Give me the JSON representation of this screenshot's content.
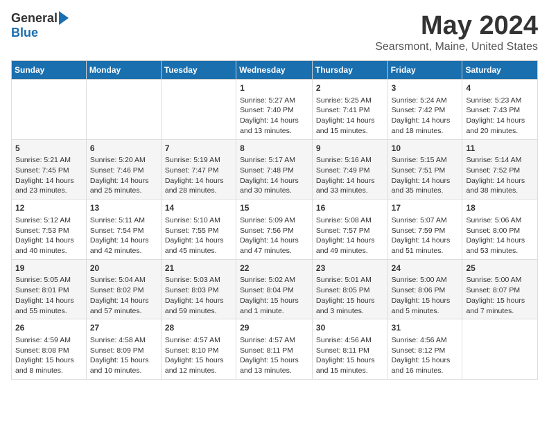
{
  "logo": {
    "general": "General",
    "blue": "Blue"
  },
  "title": "May 2024",
  "subtitle": "Searsmont, Maine, United States",
  "days_of_week": [
    "Sunday",
    "Monday",
    "Tuesday",
    "Wednesday",
    "Thursday",
    "Friday",
    "Saturday"
  ],
  "weeks": [
    [
      {
        "day": "",
        "info": ""
      },
      {
        "day": "",
        "info": ""
      },
      {
        "day": "",
        "info": ""
      },
      {
        "day": "1",
        "info": "Sunrise: 5:27 AM\nSunset: 7:40 PM\nDaylight: 14 hours\nand 13 minutes."
      },
      {
        "day": "2",
        "info": "Sunrise: 5:25 AM\nSunset: 7:41 PM\nDaylight: 14 hours\nand 15 minutes."
      },
      {
        "day": "3",
        "info": "Sunrise: 5:24 AM\nSunset: 7:42 PM\nDaylight: 14 hours\nand 18 minutes."
      },
      {
        "day": "4",
        "info": "Sunrise: 5:23 AM\nSunset: 7:43 PM\nDaylight: 14 hours\nand 20 minutes."
      }
    ],
    [
      {
        "day": "5",
        "info": "Sunrise: 5:21 AM\nSunset: 7:45 PM\nDaylight: 14 hours\nand 23 minutes."
      },
      {
        "day": "6",
        "info": "Sunrise: 5:20 AM\nSunset: 7:46 PM\nDaylight: 14 hours\nand 25 minutes."
      },
      {
        "day": "7",
        "info": "Sunrise: 5:19 AM\nSunset: 7:47 PM\nDaylight: 14 hours\nand 28 minutes."
      },
      {
        "day": "8",
        "info": "Sunrise: 5:17 AM\nSunset: 7:48 PM\nDaylight: 14 hours\nand 30 minutes."
      },
      {
        "day": "9",
        "info": "Sunrise: 5:16 AM\nSunset: 7:49 PM\nDaylight: 14 hours\nand 33 minutes."
      },
      {
        "day": "10",
        "info": "Sunrise: 5:15 AM\nSunset: 7:51 PM\nDaylight: 14 hours\nand 35 minutes."
      },
      {
        "day": "11",
        "info": "Sunrise: 5:14 AM\nSunset: 7:52 PM\nDaylight: 14 hours\nand 38 minutes."
      }
    ],
    [
      {
        "day": "12",
        "info": "Sunrise: 5:12 AM\nSunset: 7:53 PM\nDaylight: 14 hours\nand 40 minutes."
      },
      {
        "day": "13",
        "info": "Sunrise: 5:11 AM\nSunset: 7:54 PM\nDaylight: 14 hours\nand 42 minutes."
      },
      {
        "day": "14",
        "info": "Sunrise: 5:10 AM\nSunset: 7:55 PM\nDaylight: 14 hours\nand 45 minutes."
      },
      {
        "day": "15",
        "info": "Sunrise: 5:09 AM\nSunset: 7:56 PM\nDaylight: 14 hours\nand 47 minutes."
      },
      {
        "day": "16",
        "info": "Sunrise: 5:08 AM\nSunset: 7:57 PM\nDaylight: 14 hours\nand 49 minutes."
      },
      {
        "day": "17",
        "info": "Sunrise: 5:07 AM\nSunset: 7:59 PM\nDaylight: 14 hours\nand 51 minutes."
      },
      {
        "day": "18",
        "info": "Sunrise: 5:06 AM\nSunset: 8:00 PM\nDaylight: 14 hours\nand 53 minutes."
      }
    ],
    [
      {
        "day": "19",
        "info": "Sunrise: 5:05 AM\nSunset: 8:01 PM\nDaylight: 14 hours\nand 55 minutes."
      },
      {
        "day": "20",
        "info": "Sunrise: 5:04 AM\nSunset: 8:02 PM\nDaylight: 14 hours\nand 57 minutes."
      },
      {
        "day": "21",
        "info": "Sunrise: 5:03 AM\nSunset: 8:03 PM\nDaylight: 14 hours\nand 59 minutes."
      },
      {
        "day": "22",
        "info": "Sunrise: 5:02 AM\nSunset: 8:04 PM\nDaylight: 15 hours\nand 1 minute."
      },
      {
        "day": "23",
        "info": "Sunrise: 5:01 AM\nSunset: 8:05 PM\nDaylight: 15 hours\nand 3 minutes."
      },
      {
        "day": "24",
        "info": "Sunrise: 5:00 AM\nSunset: 8:06 PM\nDaylight: 15 hours\nand 5 minutes."
      },
      {
        "day": "25",
        "info": "Sunrise: 5:00 AM\nSunset: 8:07 PM\nDaylight: 15 hours\nand 7 minutes."
      }
    ],
    [
      {
        "day": "26",
        "info": "Sunrise: 4:59 AM\nSunset: 8:08 PM\nDaylight: 15 hours\nand 8 minutes."
      },
      {
        "day": "27",
        "info": "Sunrise: 4:58 AM\nSunset: 8:09 PM\nDaylight: 15 hours\nand 10 minutes."
      },
      {
        "day": "28",
        "info": "Sunrise: 4:57 AM\nSunset: 8:10 PM\nDaylight: 15 hours\nand 12 minutes."
      },
      {
        "day": "29",
        "info": "Sunrise: 4:57 AM\nSunset: 8:11 PM\nDaylight: 15 hours\nand 13 minutes."
      },
      {
        "day": "30",
        "info": "Sunrise: 4:56 AM\nSunset: 8:11 PM\nDaylight: 15 hours\nand 15 minutes."
      },
      {
        "day": "31",
        "info": "Sunrise: 4:56 AM\nSunset: 8:12 PM\nDaylight: 15 hours\nand 16 minutes."
      },
      {
        "day": "",
        "info": ""
      }
    ]
  ]
}
